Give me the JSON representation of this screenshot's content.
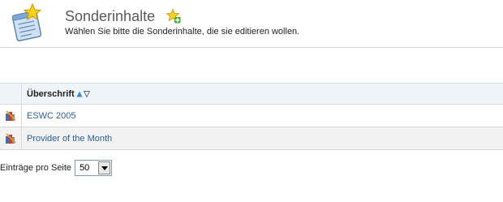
{
  "header": {
    "title": "Sonderinhalte",
    "subtitle": "Wählen Sie bitte die Sonderinhalte, die sie editieren wollen.",
    "page_icon": "notepad-star-icon",
    "add_icon": "star-add-icon"
  },
  "table": {
    "column_header": "Überschrift",
    "sort_icons": [
      "sort-ascending-icon",
      "sort-descending-icon"
    ],
    "rows": [
      {
        "label": "ESWC 2005",
        "icon": "edit-content-icon"
      },
      {
        "label": "Provider of the Month",
        "icon": "edit-content-icon"
      }
    ]
  },
  "pagination": {
    "label": "Einträge pro Seite",
    "per_page_value": "50"
  },
  "colors": {
    "link": "#2a5f9e",
    "header_bg": "#eef4f8",
    "alt_row_bg": "#f2f2f2",
    "sort_asc": "#3a8fd0"
  }
}
